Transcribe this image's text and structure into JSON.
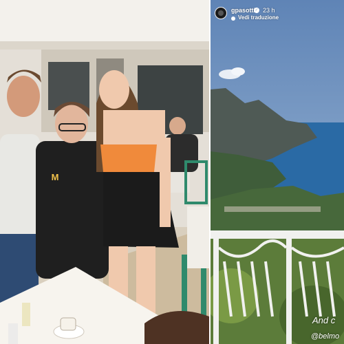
{
  "left_photo": {
    "description_icon": "restaurant-group-photo",
    "logo_letter": "M"
  },
  "story": {
    "username": "gpasotti",
    "verified_icon": "verified-badge-icon",
    "time": "23 h",
    "translate_label": "Vedi traduzione",
    "caption": "And c",
    "mention": "@belmo"
  },
  "colors": {
    "sky": "#7c9fc6",
    "sea": "#2a6aa5",
    "accent_orange": "#f08a3b"
  }
}
